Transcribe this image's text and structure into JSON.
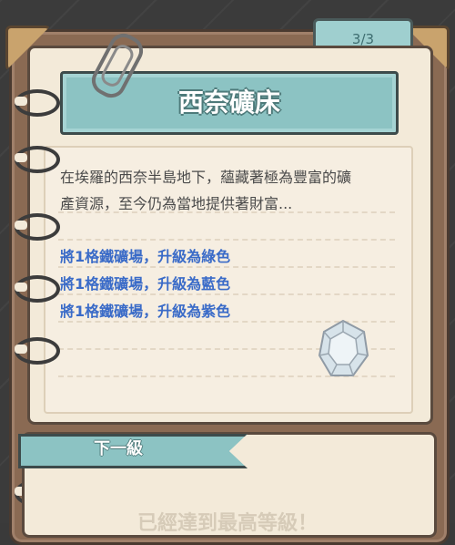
{
  "page_counter": "3/3",
  "card": {
    "title": "西奈礦床",
    "description_line1": "在埃羅的西奈半島地下，蘊藏著極為豐富的礦",
    "description_line2": "產資源，至今仍為當地提供著財富...",
    "upgrades": [
      "將1格鐵礦場，升級為綠色",
      "將1格鐵礦場，升級為藍色",
      "將1格鐵礦場，升級為紫色"
    ],
    "item_icon": "crystal-icon"
  },
  "next_level": {
    "label": "下一級",
    "status": "已經達到最高等級！"
  }
}
